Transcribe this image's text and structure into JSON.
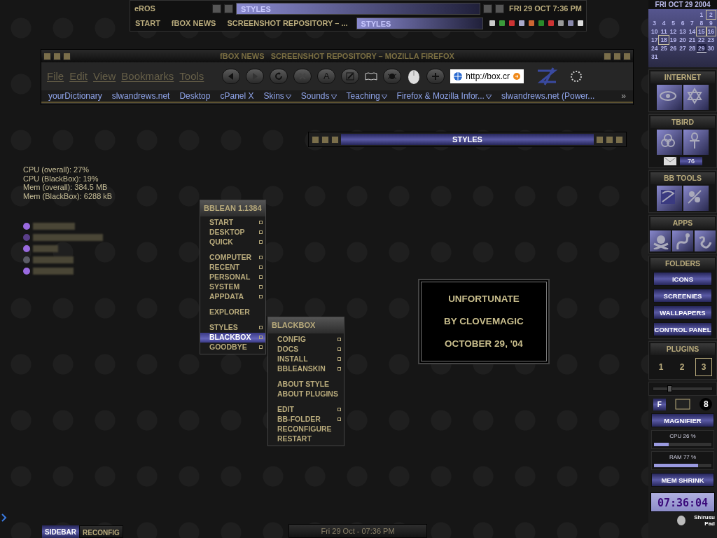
{
  "top_bar": {
    "workspace": "eROS",
    "window_field": "STYLES",
    "clock": "FRI 29 OCT 7:36 PM",
    "tasks": [
      {
        "label": "START",
        "selected": false
      },
      {
        "label": "fBOX NEWS",
        "selected": false
      },
      {
        "label": "SCREENSHOT REPOSITORY – ...",
        "selected": false
      },
      {
        "label": "STYLES",
        "selected": true
      }
    ]
  },
  "firefox": {
    "title": "fBOX NEWS   SCREENSHOT REPOSITORY – MOZILLA FIREFOX",
    "menu": [
      "File",
      "Edit",
      "View",
      "Bookmarks",
      "Tools"
    ],
    "text_button": "A",
    "url": "http://box.cr",
    "bookmarks": [
      {
        "label": "yourDictionary",
        "folder": false
      },
      {
        "label": "slwandrews.net",
        "folder": false
      },
      {
        "label": "Desktop",
        "folder": false
      },
      {
        "label": "cPanel X",
        "folder": false
      },
      {
        "label": "Skins",
        "folder": true
      },
      {
        "label": "Sounds",
        "folder": true
      },
      {
        "label": "Teaching",
        "folder": true
      },
      {
        "label": "Firefox & Mozilla Infor...",
        "folder": true
      },
      {
        "label": "slwandrews.net (Power...",
        "folder": false
      }
    ],
    "overflow": "»"
  },
  "styles_window": {
    "title": "STYLES"
  },
  "system_stats": [
    "CPU (overall): 27%",
    "CPU (BlackBox): 19%",
    "Mem (overall): 384.5 MB",
    "Mem (BlackBox): 6288 kB"
  ],
  "desktop_items": [
    {
      "color": "#9a6ae0"
    },
    {
      "color": "#5a3f8a"
    },
    {
      "color": "#9a6ae0"
    },
    {
      "color": "#5c5c66"
    },
    {
      "color": "#9a6ae0"
    }
  ],
  "main_menu": {
    "title": "BBLEAN 1.1384",
    "items": [
      {
        "kind": "item",
        "label": "START",
        "submenu": true,
        "selected": false
      },
      {
        "kind": "item",
        "label": "DESKTOP",
        "submenu": true,
        "selected": false
      },
      {
        "kind": "item",
        "label": "QUICK",
        "submenu": true,
        "selected": false
      },
      {
        "kind": "separator"
      },
      {
        "kind": "item",
        "label": "COMPUTER",
        "submenu": true,
        "selected": false
      },
      {
        "kind": "item",
        "label": "RECENT",
        "submenu": true,
        "selected": false
      },
      {
        "kind": "item",
        "label": "PERSONAL",
        "submenu": true,
        "selected": false
      },
      {
        "kind": "item",
        "label": "SYSTEM",
        "submenu": true,
        "selected": false
      },
      {
        "kind": "item",
        "label": "APPDATA",
        "submenu": true,
        "selected": false
      },
      {
        "kind": "separator"
      },
      {
        "kind": "item",
        "label": "EXPLORER",
        "submenu": false,
        "selected": false
      },
      {
        "kind": "separator"
      },
      {
        "kind": "item",
        "label": "STYLES",
        "submenu": true,
        "selected": false
      },
      {
        "kind": "item",
        "label": "BLACKBOX",
        "submenu": true,
        "selected": true
      },
      {
        "kind": "item",
        "label": "GOODBYE",
        "submenu": true,
        "selected": false
      }
    ]
  },
  "sub_menu": {
    "title": "BLACKBOX",
    "items": [
      {
        "kind": "item",
        "label": "CONFIG",
        "submenu": true,
        "selected": false
      },
      {
        "kind": "item",
        "label": "DOCS",
        "submenu": true,
        "selected": false
      },
      {
        "kind": "item",
        "label": "INSTALL",
        "submenu": true,
        "selected": false
      },
      {
        "kind": "item",
        "label": "BBLEANSKIN",
        "submenu": true,
        "selected": false
      },
      {
        "kind": "separator"
      },
      {
        "kind": "item",
        "label": "ABOUT STYLE",
        "submenu": false,
        "selected": false
      },
      {
        "kind": "item",
        "label": "ABOUT PLUGINS",
        "submenu": false,
        "selected": false
      },
      {
        "kind": "separator"
      },
      {
        "kind": "item",
        "label": "EDIT",
        "submenu": true,
        "selected": false
      },
      {
        "kind": "item",
        "label": "BB-FOLDER",
        "submenu": true,
        "selected": false
      },
      {
        "kind": "item",
        "label": "RECONFIGURE",
        "submenu": false,
        "selected": false
      },
      {
        "kind": "item",
        "label": "RESTART",
        "submenu": false,
        "selected": false
      }
    ]
  },
  "credits": [
    "UNFORTUNATE",
    "BY CLOVEMAGIC",
    "OCTOBER 29, '04"
  ],
  "sidebar": {
    "calendar": {
      "header": "FRI OCT 29 2004",
      "days": [
        {
          "day": "1",
          "marked": false,
          "today": false
        },
        {
          "day": "2",
          "marked": true,
          "today": false
        },
        {
          "day": "3",
          "marked": false,
          "today": false
        },
        {
          "day": "4",
          "marked": false,
          "today": false
        },
        {
          "day": "5",
          "marked": false,
          "today": false
        },
        {
          "day": "6",
          "marked": false,
          "today": false
        },
        {
          "day": "7",
          "marked": false,
          "today": false
        },
        {
          "day": "8",
          "marked": false,
          "today": false
        },
        {
          "day": "9",
          "marked": false,
          "today": false
        },
        {
          "day": "10",
          "marked": false,
          "today": false
        },
        {
          "day": "11",
          "marked": false,
          "today": false
        },
        {
          "day": "12",
          "marked": false,
          "today": false
        },
        {
          "day": "13",
          "marked": false,
          "today": false
        },
        {
          "day": "14",
          "marked": false,
          "today": false
        },
        {
          "day": "15",
          "marked": true,
          "today": false
        },
        {
          "day": "16",
          "marked": true,
          "today": false
        },
        {
          "day": "17",
          "marked": false,
          "today": false
        },
        {
          "day": "18",
          "marked": true,
          "today": false
        },
        {
          "day": "19",
          "marked": false,
          "today": false
        },
        {
          "day": "20",
          "marked": false,
          "today": false
        },
        {
          "day": "21",
          "marked": false,
          "today": false
        },
        {
          "day": "22",
          "marked": false,
          "today": false
        },
        {
          "day": "23",
          "marked": false,
          "today": false
        },
        {
          "day": "24",
          "marked": false,
          "today": false
        },
        {
          "day": "25",
          "marked": false,
          "today": false
        },
        {
          "day": "26",
          "marked": false,
          "today": false
        },
        {
          "day": "27",
          "marked": false,
          "today": false
        },
        {
          "day": "28",
          "marked": false,
          "today": false
        },
        {
          "day": "29",
          "marked": false,
          "today": true
        },
        {
          "day": "30",
          "marked": false,
          "today": false
        },
        {
          "day": "31",
          "marked": false,
          "today": false
        }
      ]
    },
    "panels": [
      {
        "kind": "launcher",
        "title": "INTERNET"
      },
      {
        "kind": "launcher",
        "title": "TBIRD",
        "mail_count": "76"
      },
      {
        "kind": "launcher",
        "title": "BB TOOLS"
      },
      {
        "kind": "launcher",
        "title": "APPS"
      },
      {
        "kind": "folders",
        "title": "FOLDERS",
        "buttons": [
          "ICONS",
          "SCREENIES",
          "WALLPAPERS",
          "CONTROL PANEL"
        ]
      },
      {
        "kind": "workspaces",
        "title": "PLUGINS",
        "workspaces": [
          {
            "label": "1",
            "selected": false
          },
          {
            "label": "2",
            "selected": false
          },
          {
            "label": "3",
            "selected": true
          }
        ]
      }
    ],
    "slider": {
      "level": 0.27
    },
    "tool_row": {
      "f_button": "F",
      "counter": "8"
    },
    "magnifier": "MAGNIFIER",
    "meters": [
      {
        "label": "CPU 26 %",
        "level": 0.26
      },
      {
        "label": "RAM 77 %",
        "level": 0.77
      }
    ],
    "mem_shrink": "MEM SHRINK",
    "clock": "07:36:04",
    "pad": "Shirusu Pad"
  },
  "bottom": {
    "tabs": [
      {
        "label": "SIDEBAR",
        "selected": true
      },
      {
        "label": "RECONFIG",
        "selected": false
      }
    ],
    "date": "Fri 29 Oct - 07:36 PM"
  }
}
